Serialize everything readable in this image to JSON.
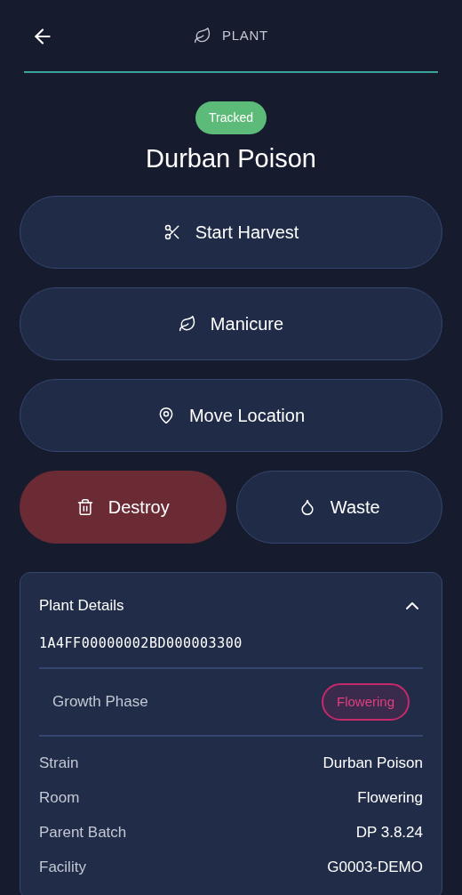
{
  "header": {
    "title": "PLANT"
  },
  "status": {
    "label": "Tracked"
  },
  "plant_name": "Durban Poison",
  "actions": [
    {
      "label": "Start Harvest",
      "kind": "wide"
    },
    {
      "label": "Manicure",
      "kind": "wide"
    },
    {
      "label": "Move Location",
      "kind": "wide"
    },
    {
      "label": "Destroy",
      "kind": "danger"
    },
    {
      "label": "Waste",
      "kind": "half"
    }
  ],
  "details": {
    "title": "Plant Details",
    "expanded": true,
    "tag": "1A4FF00000002BD000003300",
    "growth_phase": {
      "label": "Growth Phase",
      "value": "Flowering"
    },
    "rows": [
      {
        "label": "Strain",
        "value": "Durban Poison"
      },
      {
        "label": "Room",
        "value": "Flowering"
      },
      {
        "label": "Parent Batch",
        "value": "DP 3.8.24"
      },
      {
        "label": "Facility",
        "value": "G0003-DEMO"
      }
    ]
  }
}
